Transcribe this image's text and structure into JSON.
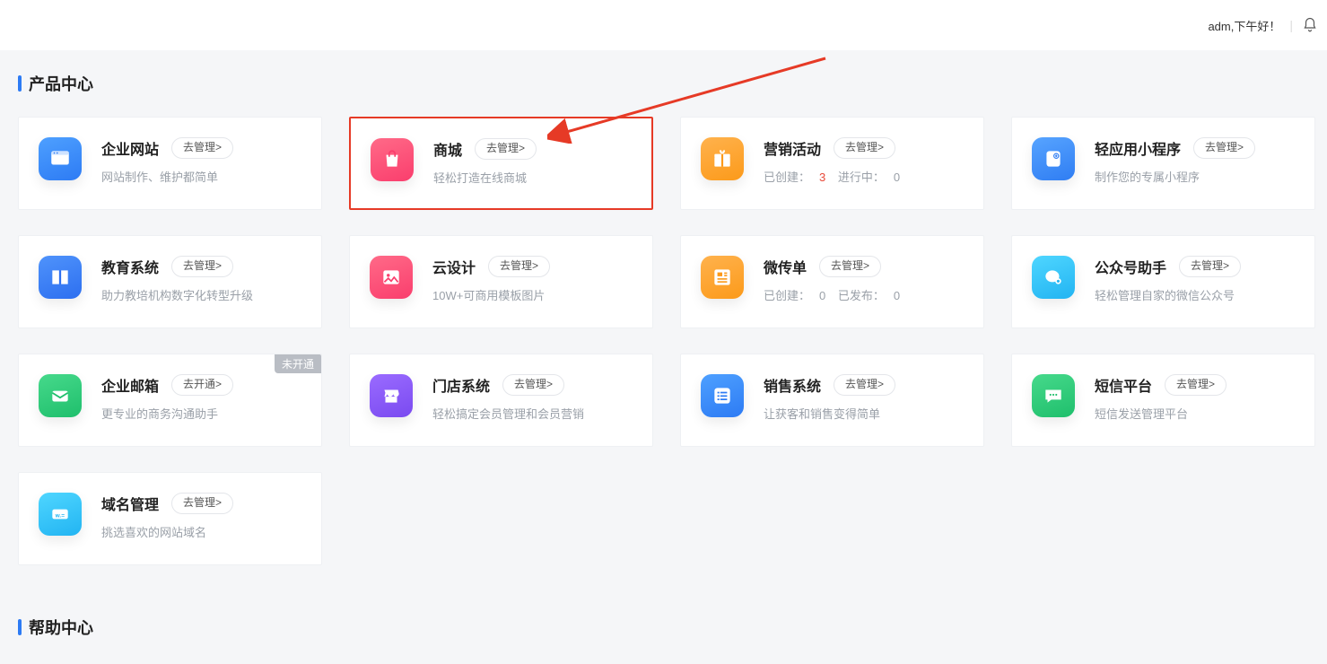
{
  "header": {
    "greeting": "adm,下午好！"
  },
  "sections": {
    "product_center": "产品中心",
    "help_center": "帮助中心"
  },
  "cards": [
    {
      "id": "website",
      "title": "企业网站",
      "button": "去管理>",
      "desc": "网站制作、维护都简单"
    },
    {
      "id": "mall",
      "title": "商城",
      "button": "去管理>",
      "desc": "轻松打造在线商城",
      "highlight": true
    },
    {
      "id": "marketing",
      "title": "营销活动",
      "button": "去管理>",
      "desc_parts": {
        "a": "已创建：",
        "an": "3",
        "b": "进行中：",
        "bn": "0"
      }
    },
    {
      "id": "miniapp",
      "title": "轻应用小程序",
      "button": "去管理>",
      "desc": "制作您的专属小程序"
    },
    {
      "id": "edu",
      "title": "教育系统",
      "button": "去管理>",
      "desc": "助力教培机构数字化转型升级"
    },
    {
      "id": "design",
      "title": "云设计",
      "button": "去管理>",
      "desc": "10W+可商用模板图片"
    },
    {
      "id": "flyer",
      "title": "微传单",
      "button": "去管理>",
      "desc_parts": {
        "a": "已创建：",
        "an": "0",
        "b": "已发布：",
        "bn": "0"
      }
    },
    {
      "id": "wechat",
      "title": "公众号助手",
      "button": "去管理>",
      "desc": "轻松管理自家的微信公众号"
    },
    {
      "id": "mail",
      "title": "企业邮箱",
      "button": "去开通>",
      "desc": "更专业的商务沟通助手",
      "badge": "未开通"
    },
    {
      "id": "store",
      "title": "门店系统",
      "button": "去管理>",
      "desc": "轻松搞定会员管理和会员营销"
    },
    {
      "id": "sales",
      "title": "销售系统",
      "button": "去管理>",
      "desc": "让获客和销售变得简单"
    },
    {
      "id": "sms",
      "title": "短信平台",
      "button": "去管理>",
      "desc": "短信发送管理平台"
    },
    {
      "id": "domain",
      "title": "域名管理",
      "button": "去管理>",
      "desc": "挑选喜欢的网站域名"
    }
  ]
}
